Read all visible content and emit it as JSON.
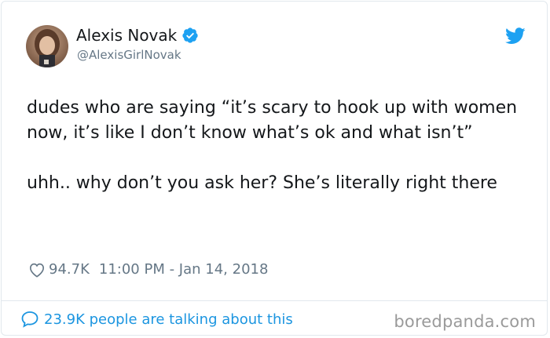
{
  "author": {
    "name": "Alexis Novak",
    "handle": "@AlexisGirlNovak",
    "verified": true,
    "avatar_icon": "avatar-photo"
  },
  "tweet": {
    "paragraphs": [
      "dudes who are saying “it’s scary to hook up with women now, it’s like I don’t know what’s ok and what isn’t”",
      "uhh.. why don’t you ask her? She’s literally right there"
    ],
    "likes": "94.7K",
    "timestamp": "11:00 PM - Jan 14, 2018"
  },
  "footer": {
    "talking": "23.9K people are talking about this",
    "watermark": "boredpanda.com"
  },
  "colors": {
    "twitter_blue": "#1da1f2",
    "link_blue": "#1b95e0",
    "text": "#14171a",
    "muted": "#657786",
    "border": "#e1e8ed"
  },
  "icons": {
    "verified": "verified-badge-icon",
    "brand": "twitter-bird-icon",
    "like": "heart-icon",
    "conversation": "speech-bubble-icon"
  }
}
